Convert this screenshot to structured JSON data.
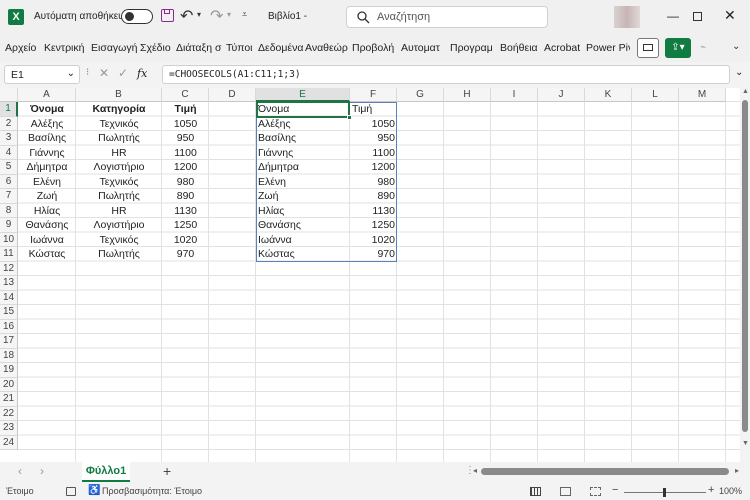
{
  "title": {
    "autosave_label": "Αυτόματη αποθήκευση",
    "filename": "Βιβλίο1 -",
    "search_placeholder": "Αναζήτηση"
  },
  "ribbon": {
    "tabs": [
      "Αρχείο",
      "Κεντρική",
      "Εισαγωγή",
      "Σχέδιο",
      "Διάταξη σ",
      "Τύποι",
      "Δεδομένα",
      "Αναθεώρ",
      "Προβολή",
      "Αυτοματ",
      "Προγραμ",
      "Βοήθεια",
      "Acrobat",
      "Power Piv"
    ]
  },
  "formula_bar": {
    "name_box": "E1",
    "fx": "fx",
    "formula": "=CHOOSECOLS(A1:C11;1;3)"
  },
  "columns": [
    "A",
    "B",
    "C",
    "D",
    "E",
    "F",
    "G",
    "H",
    "I",
    "J",
    "K",
    "L",
    "M"
  ],
  "rows": [
    "1",
    "2",
    "3",
    "4",
    "5",
    "6",
    "7",
    "8",
    "9",
    "10",
    "11",
    "12",
    "13",
    "14",
    "15",
    "16",
    "17",
    "18",
    "19",
    "20",
    "21",
    "22",
    "23",
    "24"
  ],
  "source_table": {
    "headers": [
      "Όνομα",
      "Κατηγορία",
      "Τιμή"
    ],
    "rows": [
      [
        "Αλέξης",
        "Τεχνικός",
        "1050"
      ],
      [
        "Βασίλης",
        "Πωλητής",
        "950"
      ],
      [
        "Γιάννης",
        "HR",
        "1100"
      ],
      [
        "Δήμητρα",
        "Λογιστήριο",
        "1200"
      ],
      [
        "Ελένη",
        "Τεχνικός",
        "980"
      ],
      [
        "Ζωή",
        "Πωλητής",
        "890"
      ],
      [
        "Ηλίας",
        "HR",
        "1130"
      ],
      [
        "Θανάσης",
        "Λογιστήριο",
        "1250"
      ],
      [
        "Ιωάννα",
        "Τεχνικός",
        "1020"
      ],
      [
        "Κώστας",
        "Πωλητής",
        "970"
      ]
    ]
  },
  "result_table": {
    "headers": [
      "Όνομα",
      "Τιμή"
    ],
    "rows": [
      [
        "Αλέξης",
        "1050"
      ],
      [
        "Βασίλης",
        "950"
      ],
      [
        "Γιάννης",
        "1100"
      ],
      [
        "Δήμητρα",
        "1200"
      ],
      [
        "Ελένη",
        "980"
      ],
      [
        "Ζωή",
        "890"
      ],
      [
        "Ηλίας",
        "1130"
      ],
      [
        "Θανάσης",
        "1250"
      ],
      [
        "Ιωάννα",
        "1020"
      ],
      [
        "Κώστας",
        "970"
      ]
    ]
  },
  "sheet_tabs": {
    "active": "Φύλλο1",
    "add": "+"
  },
  "status": {
    "ready": "Έτοιμο",
    "accessibility": "Προσβασιμότητα: Έτοιμο",
    "zoom": "100%"
  },
  "colors": {
    "excel_green": "#107c41",
    "selection_border": "#217346",
    "spill_border": "#5b7fbf",
    "accent_purple": "#8a2a8f"
  }
}
